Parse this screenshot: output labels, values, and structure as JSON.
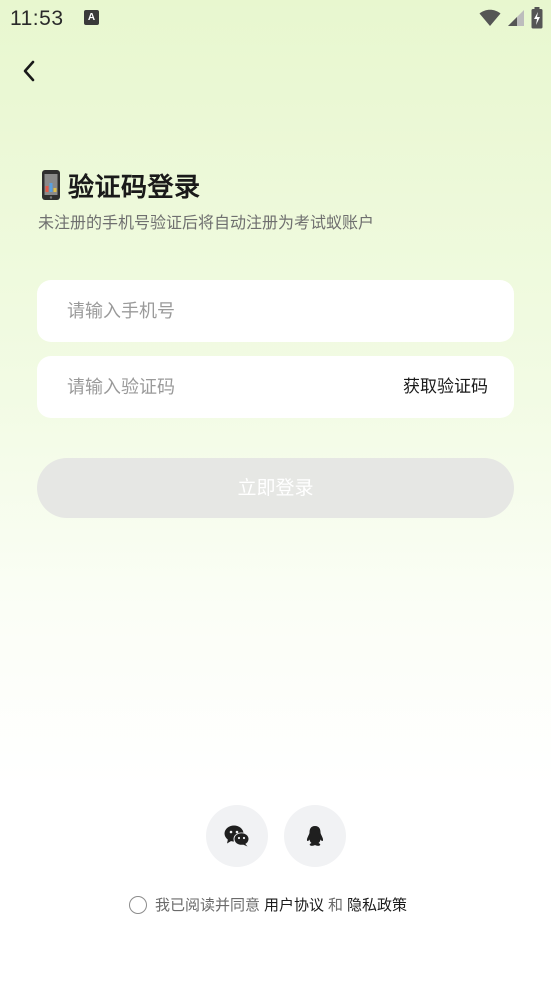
{
  "status_bar": {
    "time": "11:53",
    "notification_icon_letter": "A"
  },
  "header": {
    "back_icon": "chevron-left-icon"
  },
  "title": {
    "emoji_icon": "mobile-phone-icon",
    "text": "验证码登录",
    "subtitle": "未注册的手机号验证后将自动注册为考试蚁账户"
  },
  "form": {
    "phone_placeholder": "请输入手机号",
    "phone_value": "",
    "code_placeholder": "请输入验证码",
    "code_value": "",
    "get_code_label": "获取验证码",
    "login_label": "立即登录"
  },
  "social_login": {
    "items": [
      {
        "icon": "wechat-icon"
      },
      {
        "icon": "qq-icon"
      }
    ]
  },
  "agreement": {
    "prefix": "我已阅读并同意",
    "user_agreement": "用户协议",
    "conjunction": "和",
    "privacy_policy": "隐私政策"
  },
  "colors": {
    "background_top": "#e8f7cf",
    "background_bottom": "#ffffff",
    "button_disabled": "#e6e7e4",
    "text_primary": "#1a1a1a",
    "text_secondary": "#6f6f6f",
    "placeholder": "#9a9a9a",
    "social_button_bg": "#f1f2f4"
  }
}
